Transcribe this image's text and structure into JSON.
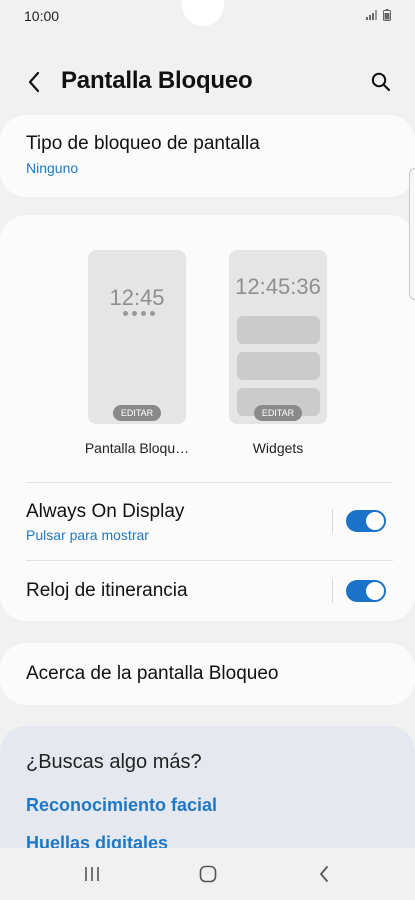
{
  "status_bar": {
    "time": "10:00"
  },
  "header": {
    "title": "Pantalla Bloqueo"
  },
  "lock_type": {
    "title": "Tipo de bloqueo de pantalla",
    "value": "Ninguno"
  },
  "previews": [
    {
      "clock": "12:45",
      "edit_label": "EDITAR",
      "caption": "Pantalla Bloqu…"
    },
    {
      "clock": "12:45:36",
      "edit_label": "EDITAR",
      "caption": "Widgets"
    }
  ],
  "always_on_display": {
    "title": "Always On Display",
    "subtitle": "Pulsar para mostrar",
    "enabled": true
  },
  "roaming_clock": {
    "title": "Reloj de itinerancia",
    "enabled": true
  },
  "about": {
    "title": "Acerca de la pantalla Bloqueo"
  },
  "more": {
    "title": "¿Buscas algo más?",
    "links": [
      "Reconocimiento facial",
      "Huellas digitales"
    ]
  },
  "colors": {
    "accent": "#1a73c8",
    "link": "#1f78c6",
    "background": "#f1f1f1",
    "card": "#fbfbfb"
  }
}
